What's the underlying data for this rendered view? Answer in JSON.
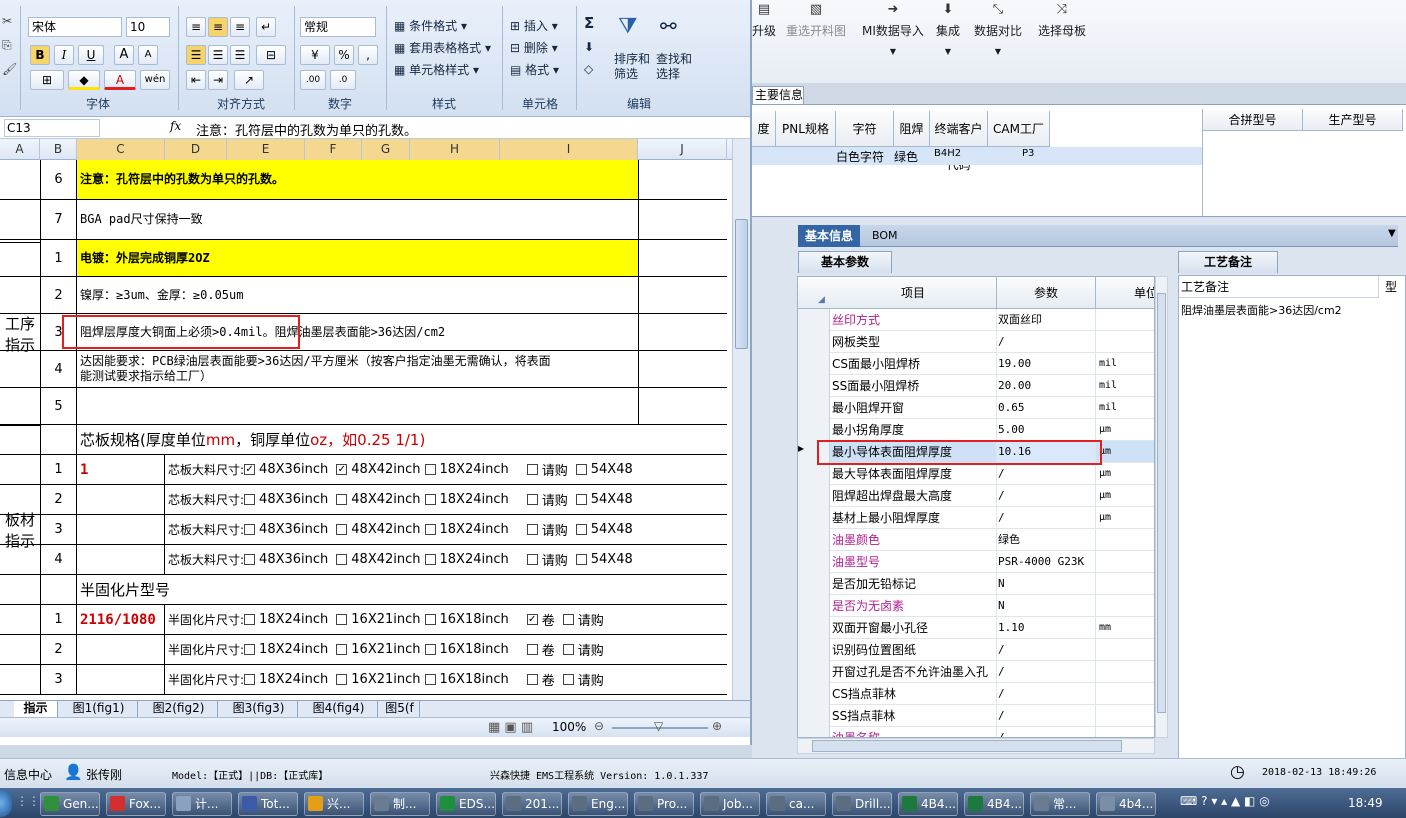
{
  "excel": {
    "ribbon": {
      "font_name": "宋体",
      "font_size": "10",
      "bold": "B",
      "italic": "I",
      "underline": "U",
      "grow": "A",
      "shrink": "A",
      "wen": "wén",
      "fill_a": "A",
      "number_format": "常规",
      "percent": "%",
      "comma": ",",
      "dec_up": ".00",
      "dec_down": ".0",
      "cond_format": "条件格式",
      "table_format": "套用表格格式",
      "cell_style": "单元格样式",
      "insert": "插入",
      "delete": "删除",
      "format": "格式",
      "sigma": "Σ",
      "sort_filter": "排序和\n筛选",
      "find_select": "查找和\n选择",
      "groups": [
        "字体",
        "对齐方式",
        "数字",
        "样式",
        "单元格",
        "编辑"
      ]
    },
    "name_box": "C13",
    "fx": "fx",
    "formula": "注意：孔符层中的孔数为单只的孔数。",
    "columns": [
      "A",
      "B",
      "C",
      "D",
      "E",
      "F",
      "G",
      "H",
      "I",
      "J"
    ],
    "side_labels": [
      "工序\n指示",
      "板材\n指示"
    ],
    "rows": [
      {
        "n": "6",
        "text": "注意：孔符层中的孔数为单只的孔数。",
        "bg": "#ffff00"
      },
      {
        "n": "7",
        "text": "BGA pad尺寸保持一致",
        "bg": "#ffffff"
      },
      {
        "n": "1",
        "text": "电镀：外层完成铜厚2OZ",
        "bg": "#ffff00"
      },
      {
        "n": "2",
        "text": "镍厚：≥3um、金厚：≥0.05um",
        "bg": "#ffffff"
      },
      {
        "n": "3",
        "text": "阻焊层厚度大铜面上必须>0.4mil。阻焊油墨层表面能>36达因/cm2",
        "bg": "#ffffff"
      },
      {
        "n": "4",
        "text": "达因能要求：PCB绿油层表面能要>36达因/平方厘米（按客户指定油墨无需确认，将表面\n能测试要求指示给工厂）",
        "bg": "#ffffff"
      },
      {
        "n": "5",
        "text": "",
        "bg": "#ffffff"
      }
    ],
    "core_title_a": "芯板规格(厚度单位",
    "core_title_mm": "mm",
    "core_title_b": "，铜厚单位",
    "core_title_oz": "oz",
    "core_title_c": "，如0.25 1/1)",
    "core_rows": [
      {
        "n": "1",
        "c": "1",
        "label": "芯板大料尺寸:",
        "opts": [
          {
            "t": "48X36inch",
            "on": true
          },
          {
            "t": "48X42inch",
            "on": true
          },
          {
            "t": "18X24inch",
            "on": false
          },
          {
            "t": "请购",
            "on": false
          },
          {
            "t": "54X48",
            "on": false
          }
        ]
      },
      {
        "n": "2",
        "c": "",
        "label": "芯板大料尺寸:",
        "opts": [
          {
            "t": "48X36inch",
            "on": false
          },
          {
            "t": "48X42inch",
            "on": false
          },
          {
            "t": "18X24inch",
            "on": false
          },
          {
            "t": "请购",
            "on": false
          },
          {
            "t": "54X48",
            "on": false
          }
        ]
      },
      {
        "n": "3",
        "c": "",
        "label": "芯板大料尺寸:",
        "opts": [
          {
            "t": "48X36inch",
            "on": false
          },
          {
            "t": "48X42inch",
            "on": false
          },
          {
            "t": "18X24inch",
            "on": false
          },
          {
            "t": "请购",
            "on": false
          },
          {
            "t": "54X48",
            "on": false
          }
        ]
      },
      {
        "n": "4",
        "c": "",
        "label": "芯板大料尺寸:",
        "opts": [
          {
            "t": "48X36inch",
            "on": false
          },
          {
            "t": "48X42inch",
            "on": false
          },
          {
            "t": "18X24inch",
            "on": false
          },
          {
            "t": "请购",
            "on": false
          },
          {
            "t": "54X48",
            "on": false
          }
        ]
      }
    ],
    "pp_title": "半固化片型号",
    "pp_rows": [
      {
        "n": "1",
        "c": "2116/1080",
        "label": "半固化片尺寸:",
        "opts": [
          {
            "t": "18X24inch",
            "on": false
          },
          {
            "t": "16X21inch",
            "on": false
          },
          {
            "t": "16X18inch",
            "on": false
          },
          {
            "t": "卷",
            "on": true
          },
          {
            "t": "请购",
            "on": false
          }
        ]
      },
      {
        "n": "2",
        "c": "",
        "label": "半固化片尺寸:",
        "opts": [
          {
            "t": "18X24inch",
            "on": false
          },
          {
            "t": "16X21inch",
            "on": false
          },
          {
            "t": "16X18inch",
            "on": false
          },
          {
            "t": "卷",
            "on": false
          },
          {
            "t": "请购",
            "on": false
          }
        ]
      },
      {
        "n": "3",
        "c": "",
        "label": "半固化片尺寸:",
        "opts": [
          {
            "t": "18X24inch",
            "on": false
          },
          {
            "t": "16X21inch",
            "on": false
          },
          {
            "t": "16X18inch",
            "on": false
          },
          {
            "t": "卷",
            "on": false
          },
          {
            "t": "请购",
            "on": false
          }
        ]
      }
    ],
    "sheet_tabs": [
      "指示",
      "图1(fig1)",
      "图2(fig2)",
      "图3(fig3)",
      "图4(fig4)",
      "图5(f"
    ],
    "zoom": "100%"
  },
  "app": {
    "toolbar": [
      {
        "label": "升级",
        "icon": "▤"
      },
      {
        "label": "重选开料图",
        "icon": "▧"
      },
      {
        "label": "MI数据导入",
        "icon": "➜"
      },
      {
        "label": "集成",
        "icon": "⬇"
      },
      {
        "label": "数据对比",
        "icon": "⤡"
      },
      {
        "label": "选择母板",
        "icon": "⤨"
      }
    ],
    "info_tab": "主要信息",
    "top_headers": [
      "度",
      "PNL规格",
      "字符",
      "阻焊",
      "终端客户代码",
      "CAM工厂"
    ],
    "top_values": {
      "char": "白色字符",
      "solder": "绿色",
      "customer": "B4H2",
      "cam": "P3"
    },
    "merge_headers": [
      "合拼型号",
      "生产型号"
    ],
    "bottom_tabs": [
      "基本信息",
      "BOM"
    ],
    "sub_tab": "基本参数",
    "param_headers": [
      "项目",
      "参数",
      "单位"
    ],
    "params": [
      {
        "name": "丝印方式",
        "value": "双面丝印",
        "unit": "",
        "color": "#b0208f"
      },
      {
        "name": "网板类型",
        "value": "/",
        "unit": "",
        "color": "#000000"
      },
      {
        "name": "CS面最小阻焊桥",
        "value": "19.00",
        "unit": "mil",
        "color": "#000000"
      },
      {
        "name": "SS面最小阻焊桥",
        "value": "20.00",
        "unit": "mil",
        "color": "#000000"
      },
      {
        "name": "最小阻焊开窗",
        "value": "0.65",
        "unit": "mil",
        "color": "#000000"
      },
      {
        "name": "最小拐角厚度",
        "value": "5.00",
        "unit": "μm",
        "color": "#000000"
      },
      {
        "name": "最小导体表面阻焊厚度",
        "value": "10.16",
        "unit": "μm",
        "color": "#000000"
      },
      {
        "name": "最大导体表面阻焊厚度",
        "value": "/",
        "unit": "μm",
        "color": "#000000"
      },
      {
        "name": "阻焊超出焊盘最大高度",
        "value": "/",
        "unit": "μm",
        "color": "#000000"
      },
      {
        "name": "基材上最小阻焊厚度",
        "value": "/",
        "unit": "μm",
        "color": "#000000"
      },
      {
        "name": "油墨颜色",
        "value": "绿色",
        "unit": "",
        "color": "#b0208f"
      },
      {
        "name": "油墨型号",
        "value": "PSR-4000 G23K",
        "unit": "",
        "color": "#b0208f"
      },
      {
        "name": "是否加无铅标记",
        "value": "N",
        "unit": "",
        "color": "#000000"
      },
      {
        "name": "是否为无卤素",
        "value": "N",
        "unit": "",
        "color": "#b0208f"
      },
      {
        "name": "双面开窗最小孔径",
        "value": "1.10",
        "unit": "mm",
        "color": "#000000"
      },
      {
        "name": "识别码位置图纸",
        "value": "/",
        "unit": "",
        "color": "#000000"
      },
      {
        "name": "开窗过孔是否不允许油墨入孔",
        "value": "/",
        "unit": "",
        "color": "#000000"
      },
      {
        "name": "CS挡点菲林",
        "value": "/",
        "unit": "",
        "color": "#000000"
      },
      {
        "name": "SS挡点菲林",
        "value": "/",
        "unit": "",
        "color": "#000000"
      },
      {
        "name": "油墨名称",
        "value": "/",
        "unit": "",
        "color": "#b0208f"
      }
    ],
    "process_tab": "工艺备注",
    "process_header": "工艺备注",
    "process_header_b": "型",
    "process_note": "阻焊油墨层表面能>36达因/cm2",
    "status": {
      "info_center": "信息中心",
      "user": "张传刚",
      "model": "Model:【正式】||DB:【正式库】",
      "system": "兴森快捷  EMS工程系统  Version: 1.0.1.337",
      "datetime": "2018-02-13 18:49:26"
    }
  },
  "taskbar": {
    "items": [
      {
        "t": "Gen...",
        "c": "#2f8f3a"
      },
      {
        "t": "Fox...",
        "c": "#d32f2f"
      },
      {
        "t": "计...",
        "c": "#8aa2c0"
      },
      {
        "t": "Tot...",
        "c": "#3b5ba8"
      },
      {
        "t": "兴...",
        "c": "#e3a017"
      },
      {
        "t": "制...",
        "c": "#6b7c90"
      },
      {
        "t": "EDS...",
        "c": "#1e8f3c"
      },
      {
        "t": "201...",
        "c": "#5c6d82"
      },
      {
        "t": "Eng...",
        "c": "#5c6d82"
      },
      {
        "t": "Pro...",
        "c": "#5c6d82"
      },
      {
        "t": "Job...",
        "c": "#5c6d82"
      },
      {
        "t": "ca...",
        "c": "#5c6d82"
      },
      {
        "t": "Drill...",
        "c": "#5c6d82"
      },
      {
        "t": "4B4...",
        "c": "#1e7a3c"
      },
      {
        "t": "4B4...",
        "c": "#1e7a3c"
      },
      {
        "t": "常...",
        "c": "#6b7c90"
      },
      {
        "t": "4b4...",
        "c": "#7a8ea6"
      }
    ],
    "clock": "18:49"
  }
}
